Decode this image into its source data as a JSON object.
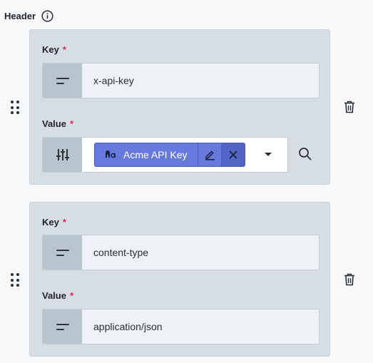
{
  "header": {
    "title": "Header",
    "info_icon": "info-icon"
  },
  "rows": [
    {
      "key_label": "Key",
      "key_required": "*",
      "key_value": "x-api-key",
      "value_label": "Value",
      "value_required": "*",
      "value_chip_label": "Acme API Key",
      "value_chip_icon": "secret-icon",
      "value_mode_icon": "sliders-icon"
    },
    {
      "key_label": "Key",
      "key_required": "*",
      "key_value": "content-type",
      "value_label": "Value",
      "value_required": "*",
      "value_value": "application/json"
    }
  ],
  "colors": {
    "card_bg": "#d6dde3",
    "prefix_bg": "#b8c4ce",
    "chip_bg": "#6779dc",
    "required": "#e0234e"
  }
}
